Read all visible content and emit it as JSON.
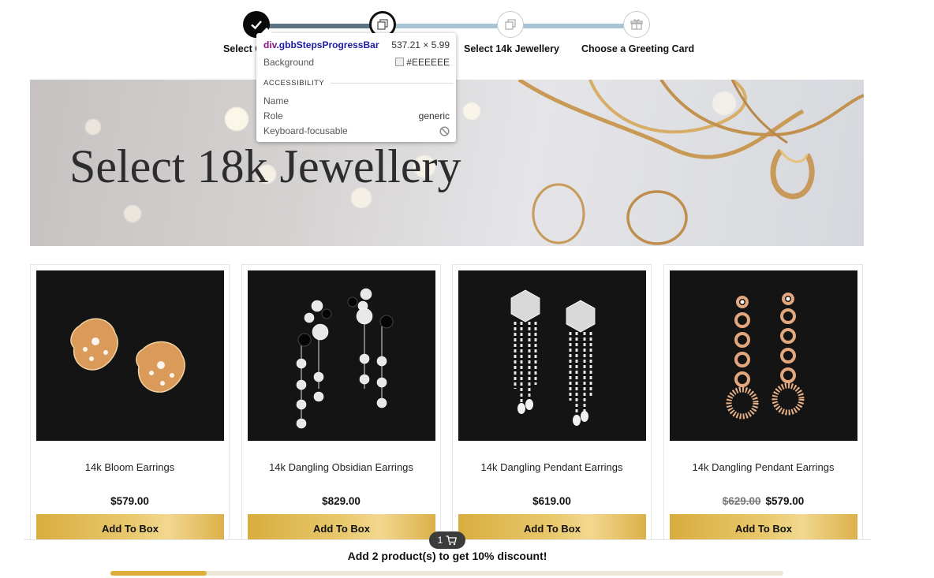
{
  "steps": [
    {
      "label": "Select 18k Jewellery",
      "state": "done",
      "icon": "checkmark-icon"
    },
    {
      "label": "",
      "state": "active",
      "icon": "copy-icon"
    },
    {
      "label": "Select 14k Jewellery",
      "state": "pending",
      "icon": "copy-icon"
    },
    {
      "label": "Choose a Greeting Card",
      "state": "pending",
      "icon": "gift-icon"
    }
  ],
  "step_first_label_visible": "Select C",
  "inspector": {
    "selector_tag": "div",
    "selector_class": ".gbbStepsProgressBar",
    "dimensions": "537.21 × 5.99",
    "background_label": "Background",
    "background_value": "#EEEEEE",
    "section": "ACCESSIBILITY",
    "name_label": "Name",
    "role_label": "Role",
    "role_value": "generic",
    "focus_label": "Keyboard-focusable"
  },
  "banner": {
    "title": "Select 18k Jewellery"
  },
  "products": [
    {
      "name": "14k Bloom Earrings",
      "old_price": "",
      "price": "$579.00",
      "button": "Add To Box",
      "image": "bloom-earrings"
    },
    {
      "name": "14k Dangling Obsidian Earrings",
      "old_price": "",
      "price": "$829.00",
      "button": "Add To Box",
      "image": "obsidian-earrings"
    },
    {
      "name": "14k Dangling Pendant Earrings",
      "old_price": "",
      "price": "$619.00",
      "button": "Add To Box",
      "image": "pendant-earrings"
    },
    {
      "name": "14k Dangling Pendant Earrings",
      "old_price": "$629.00",
      "price": "$579.00",
      "button": "Add To Box",
      "image": "rose-gold-pendant-earrings"
    }
  ],
  "cart": {
    "count": "1",
    "icon": "cart-icon"
  },
  "discount": {
    "message": "Add 2 product(s) to get 10% discount!",
    "progress": 0.143
  },
  "colors": {
    "gold": "#deae3c",
    "dark": "#141414",
    "step_done": "#5a7486",
    "step_pending": "#a9c3d6"
  }
}
